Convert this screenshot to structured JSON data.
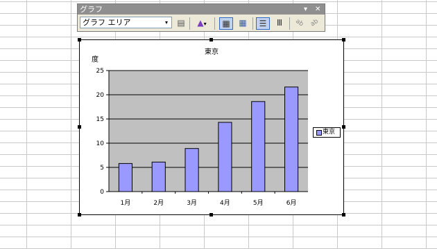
{
  "toolbar": {
    "title": "グラフ",
    "dropdown_arrow": "▾",
    "close_glyph": "✕",
    "selector_value": "グラフ エリア",
    "buttons": [
      {
        "name": "format-selection-button",
        "icon": "format-icon",
        "glyph": "▤"
      },
      {
        "name": "chart-type-button",
        "icon": "chart-type-icon",
        "glyph": "▲"
      },
      {
        "name": "legend-button",
        "icon": "legend-icon",
        "glyph": "▦"
      },
      {
        "name": "data-table-button",
        "icon": "data-table-icon",
        "glyph": "▦"
      },
      {
        "name": "by-row-button",
        "icon": "by-row-icon",
        "glyph": "☰"
      },
      {
        "name": "by-column-button",
        "icon": "by-column-icon",
        "glyph": "Ⅲ"
      },
      {
        "name": "angle-text-down-button",
        "icon": "angle-down-icon",
        "glyph": "ab"
      },
      {
        "name": "angle-text-up-button",
        "icon": "angle-up-icon",
        "glyph": "ab"
      }
    ]
  },
  "colors": {
    "bar": "#9999ff",
    "plot_bg": "#c0c0c0"
  },
  "chart_data": {
    "type": "bar",
    "title": "東京",
    "ylabel": "度",
    "xlabel": "",
    "categories": [
      "1月",
      "2月",
      "3月",
      "4月",
      "5月",
      "6月"
    ],
    "series": [
      {
        "name": "東京",
        "values": [
          5.8,
          6.1,
          8.9,
          14.3,
          18.6,
          21.6
        ]
      }
    ],
    "ylim": [
      0,
      25
    ],
    "yticks": [
      "0",
      "5",
      "10",
      "15",
      "20",
      "25"
    ],
    "grid": true,
    "legend": "right"
  }
}
